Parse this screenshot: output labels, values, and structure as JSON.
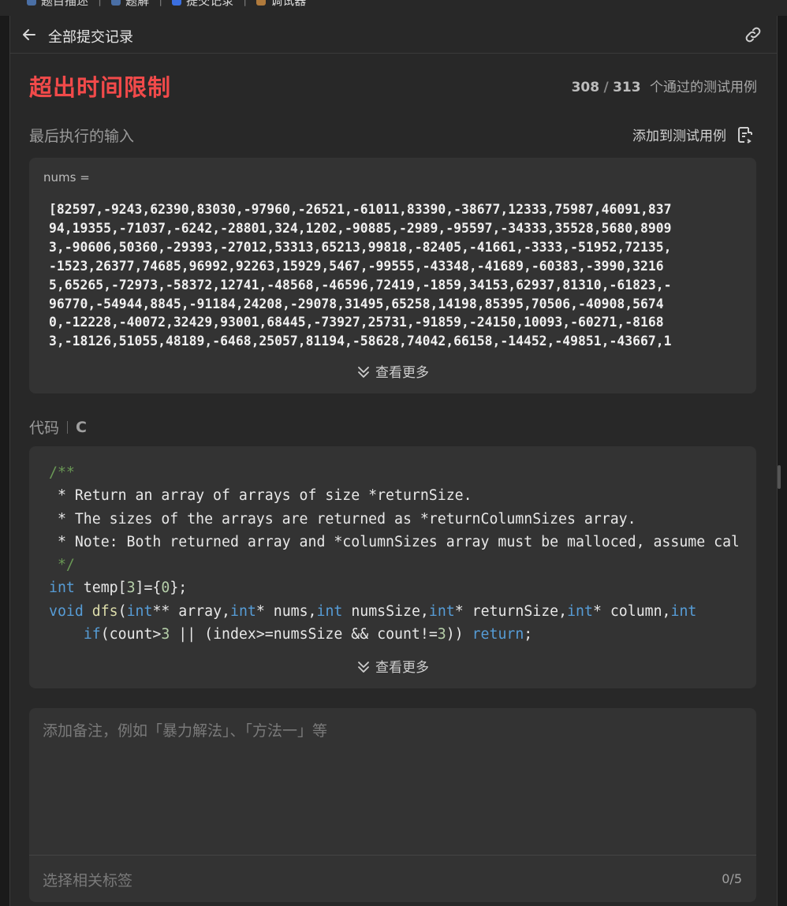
{
  "top_tabs": [
    {
      "label": "题目描述",
      "color": "#4a6fa5"
    },
    {
      "label": "题解",
      "color": "#4a6fa5"
    },
    {
      "label": "提交记录",
      "color": "#3b6fe0"
    },
    {
      "label": "调试器",
      "color": "#b07a3c"
    }
  ],
  "header": {
    "title": "全部提交记录"
  },
  "result": {
    "status": "超出时间限制",
    "passed": "308",
    "slash": "/",
    "total": "313",
    "passed_label": "个通过的测试用例"
  },
  "last_input": {
    "label": "最后执行的输入",
    "add_to_testcase": "添加到测试用例",
    "var_name": "nums =",
    "lines": [
      "[82597,-9243,62390,83030,-97960,-26521,-61011,83390,-38677,12333,75987,46091,837",
      "94,19355,-71037,-6242,-28801,324,1202,-90885,-2989,-95597,-34333,35528,5680,8909",
      "3,-90606,50360,-29393,-27012,53313,65213,99818,-82405,-41661,-3333,-51952,72135,",
      "-1523,26377,74685,96992,92263,15929,5467,-99555,-43348,-41689,-60383,-3990,3216",
      "5,65265,-72973,-58372,12741,-48568,-46596,72419,-1859,34153,62937,81310,-61823,-",
      "96770,-54944,8845,-91184,24208,-29078,31495,65258,14198,85395,70506,-40908,5674",
      "0,-12228,-40072,32429,93001,68445,-73927,25731,-91859,-24150,10093,-60271,-8168",
      "3,-18126,51055,48189,-6468,25057,81194,-58628,74042,66158,-14452,-49851,-43667,1"
    ],
    "more": "查看更多"
  },
  "code": {
    "label": "代码",
    "language": "C",
    "lines": [
      [
        {
          "t": "/**",
          "c": "comment"
        }
      ],
      [
        {
          "t": " * Return an array of arrays of size *returnSize.",
          "c": "plain"
        }
      ],
      [
        {
          "t": " * The sizes of the arrays are returned as *returnColumnSizes array.",
          "c": "plain"
        }
      ],
      [
        {
          "t": " * Note: Both returned array and *columnSizes array must be malloced, assume caller calls free().",
          "c": "plain"
        }
      ],
      [
        {
          "t": " */",
          "c": "comment"
        }
      ],
      [
        {
          "t": "int",
          "c": "kw"
        },
        {
          "t": " temp[",
          "c": "plain"
        },
        {
          "t": "3",
          "c": "num"
        },
        {
          "t": "]={",
          "c": "plain"
        },
        {
          "t": "0",
          "c": "num"
        },
        {
          "t": "};",
          "c": "plain"
        }
      ],
      [
        {
          "t": "void",
          "c": "kw"
        },
        {
          "t": " ",
          "c": "plain"
        },
        {
          "t": "dfs",
          "c": "fn"
        },
        {
          "t": "(",
          "c": "plain"
        },
        {
          "t": "int",
          "c": "kw"
        },
        {
          "t": "** array,",
          "c": "plain"
        },
        {
          "t": "int",
          "c": "kw"
        },
        {
          "t": "* nums,",
          "c": "plain"
        },
        {
          "t": "int",
          "c": "kw"
        },
        {
          "t": " numsSize,",
          "c": "plain"
        },
        {
          "t": "int",
          "c": "kw"
        },
        {
          "t": "* returnSize,",
          "c": "plain"
        },
        {
          "t": "int",
          "c": "kw"
        },
        {
          "t": "* column,",
          "c": "plain"
        },
        {
          "t": "int",
          "c": "kw"
        }
      ],
      [
        {
          "t": "    ",
          "c": "plain"
        },
        {
          "t": "if",
          "c": "kw"
        },
        {
          "t": "(count>",
          "c": "plain"
        },
        {
          "t": "3",
          "c": "num"
        },
        {
          "t": " || (index>=numsSize && count!=",
          "c": "plain"
        },
        {
          "t": "3",
          "c": "num"
        },
        {
          "t": ")) ",
          "c": "plain"
        },
        {
          "t": "return",
          "c": "kw"
        },
        {
          "t": ";",
          "c": "plain"
        }
      ]
    ],
    "more": "查看更多"
  },
  "note": {
    "placeholder": "添加备注，例如「暴力解法」、「方法一」等",
    "tag_placeholder": "选择相关标签",
    "tag_count": "0/5"
  },
  "colors": {
    "error": "#f24a4a",
    "card_bg": "#333333",
    "panel_bg": "#282828",
    "comment": "#6a9955",
    "keyword": "#569cd6"
  }
}
